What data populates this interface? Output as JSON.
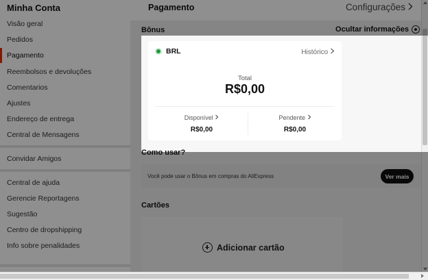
{
  "sidebar": {
    "title": "Minha Conta",
    "items": [
      {
        "label": "Visão geral",
        "active": false
      },
      {
        "label": "Pedidos",
        "active": false
      },
      {
        "label": "Pagamento",
        "active": true
      },
      {
        "label": "Reembolsos e devoluções",
        "active": false
      },
      {
        "label": "Comentarios",
        "active": false
      },
      {
        "label": "Ajustes",
        "active": false
      },
      {
        "label": "Endereço de entrega",
        "active": false
      },
      {
        "label": "Central de Mensagens",
        "active": false
      },
      {
        "label": "Convidar Amigos",
        "active": false
      },
      {
        "label": "Central de ajuda",
        "active": false
      },
      {
        "label": "Gerencie Reportagens",
        "active": false
      },
      {
        "label": "Sugestão",
        "active": false
      },
      {
        "label": "Centro de dropshipping",
        "active": false
      },
      {
        "label": "Info sobre penalidades",
        "active": false
      }
    ]
  },
  "payment": {
    "title": "Pagamento",
    "config_label": "Configurações",
    "config_icon": "chevron-right-icon"
  },
  "bonus": {
    "label": "Bônus",
    "hide_info_label": "Ocultar informações",
    "hide_info_icon": "eye-icon",
    "currency": "BRL",
    "history_label": "Histórico",
    "total_label": "Total",
    "total_value": "R$0,00",
    "available_label": "Disponível",
    "available_value": "R$0,00",
    "pending_label": "Pendente",
    "pending_value": "R$0,00"
  },
  "howto": {
    "label": "Como usar?",
    "text": "Você pode usar o Bônus em compras do AliExpress",
    "button_label": "Ver mais"
  },
  "cards": {
    "label": "Cartões",
    "add_label": "Adicionar cartão",
    "add_icon": "plus-circle-icon"
  },
  "colors": {
    "accent": "#e62e04",
    "overlay": "rgba(0,0,0,0.44)",
    "currency_badge": "#1f9a3a"
  }
}
